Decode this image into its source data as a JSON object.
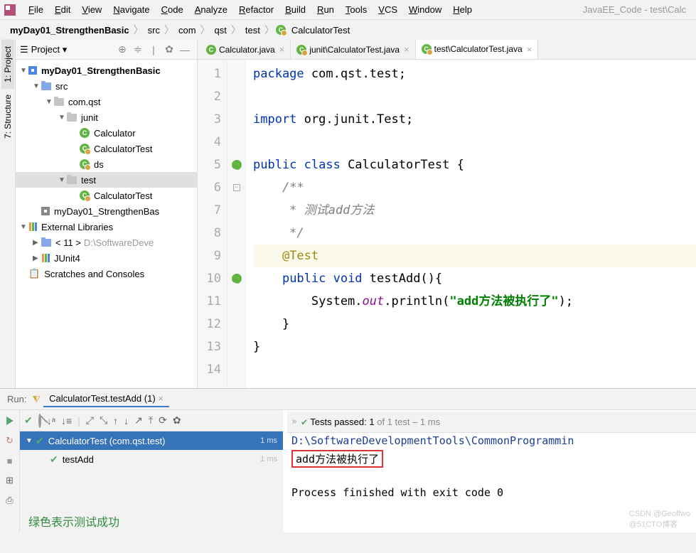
{
  "app_title": "JavaEE_Code - test\\Calc",
  "menu": [
    "File",
    "Edit",
    "View",
    "Navigate",
    "Code",
    "Analyze",
    "Refactor",
    "Build",
    "Run",
    "Tools",
    "VCS",
    "Window",
    "Help"
  ],
  "breadcrumb": [
    "myDay01_StrengthenBasic",
    "src",
    "com",
    "qst",
    "test",
    "CalculatorTest"
  ],
  "left_tabs": {
    "project": "1: Project",
    "structure": "7: Structure"
  },
  "project_panel": {
    "title": "Project",
    "tree": [
      {
        "d": 0,
        "arrow": "▼",
        "type": "module",
        "label": "myDay01_StrengthenBasic",
        "bold": true
      },
      {
        "d": 1,
        "arrow": "▼",
        "type": "folder-blue",
        "label": "src"
      },
      {
        "d": 2,
        "arrow": "▼",
        "type": "folder",
        "label": "com.qst"
      },
      {
        "d": 3,
        "arrow": "▼",
        "type": "folder",
        "label": "junit"
      },
      {
        "d": 4,
        "arrow": "",
        "type": "class",
        "label": "Calculator"
      },
      {
        "d": 4,
        "arrow": "",
        "type": "class-test",
        "label": "CalculatorTest"
      },
      {
        "d": 4,
        "arrow": "",
        "type": "class-test",
        "label": "ds"
      },
      {
        "d": 3,
        "arrow": "▼",
        "type": "folder",
        "label": "test",
        "selected": true
      },
      {
        "d": 4,
        "arrow": "",
        "type": "class-test",
        "label": "CalculatorTest"
      },
      {
        "d": 1,
        "arrow": "",
        "type": "iml",
        "label": "myDay01_StrengthenBas"
      },
      {
        "d": 0,
        "arrow": "▼",
        "type": "lib",
        "label": "External Libraries"
      },
      {
        "d": 1,
        "arrow": "▶",
        "type": "folder-blue",
        "label": "< 11 >",
        "extra": "D:\\SoftwareDeve"
      },
      {
        "d": 1,
        "arrow": "▶",
        "type": "lib",
        "label": "JUnit4"
      },
      {
        "d": 0,
        "arrow": "",
        "type": "scratch",
        "label": "Scratches and Consoles"
      }
    ]
  },
  "tabs": [
    {
      "label": "Calculator.java",
      "icon": "class"
    },
    {
      "label": "junit\\CalculatorTest.java",
      "icon": "class-test"
    },
    {
      "label": "test\\CalculatorTest.java",
      "icon": "class-test",
      "active": true
    }
  ],
  "code": [
    {
      "n": 1,
      "html": "<span class='kw'>package</span> com.qst.test;"
    },
    {
      "n": 2,
      "html": ""
    },
    {
      "n": 3,
      "html": "<span class='kw'>import</span> org.junit.Test;"
    },
    {
      "n": 4,
      "html": ""
    },
    {
      "n": 5,
      "html": "<span class='kw'>public class</span> CalculatorTest {",
      "run": true
    },
    {
      "n": 6,
      "html": "    <span class='com'>/**</span>",
      "collapse": true
    },
    {
      "n": 7,
      "html": "<span class='com'>     * 测试add方法</span>"
    },
    {
      "n": 8,
      "html": "<span class='com'>     */</span>"
    },
    {
      "n": 9,
      "html": "    <span class='ann'>@Test</span>",
      "hl": true
    },
    {
      "n": 10,
      "html": "    <span class='kw'>public void</span> testAdd(){",
      "run": true
    },
    {
      "n": 11,
      "html": "        System.<span class='static'>out</span>.println(<span class='str2'>\"add方法被执行了\"</span>);"
    },
    {
      "n": 12,
      "html": "    }"
    },
    {
      "n": 13,
      "html": "}"
    },
    {
      "n": 14,
      "html": ""
    }
  ],
  "run": {
    "label": "Run:",
    "test_tab": "CalculatorTest.testAdd (1)",
    "passed_text": "Tests passed: 1 of 1 test – 1 ms",
    "tree": [
      {
        "d": 0,
        "label": "CalculatorTest (com.qst.test)",
        "time": "1 ms",
        "sel": true,
        "arrow": "▼"
      },
      {
        "d": 1,
        "label": "testAdd",
        "time": "1 ms",
        "arrow": ""
      }
    ],
    "annotation": "绿色表示测试成功",
    "output": [
      {
        "cls": "blue",
        "text": "D:\\SoftwareDevelopmentTools\\CommonProgrammin"
      },
      {
        "cls": "boxed",
        "text": "add方法被执行了"
      },
      {
        "cls": "",
        "text": ""
      },
      {
        "cls": "",
        "text": "Process finished with exit code 0"
      }
    ]
  },
  "watermarks": {
    "csdn": "CSDN @Geoffwo",
    "blog": "@51CTO博客"
  }
}
